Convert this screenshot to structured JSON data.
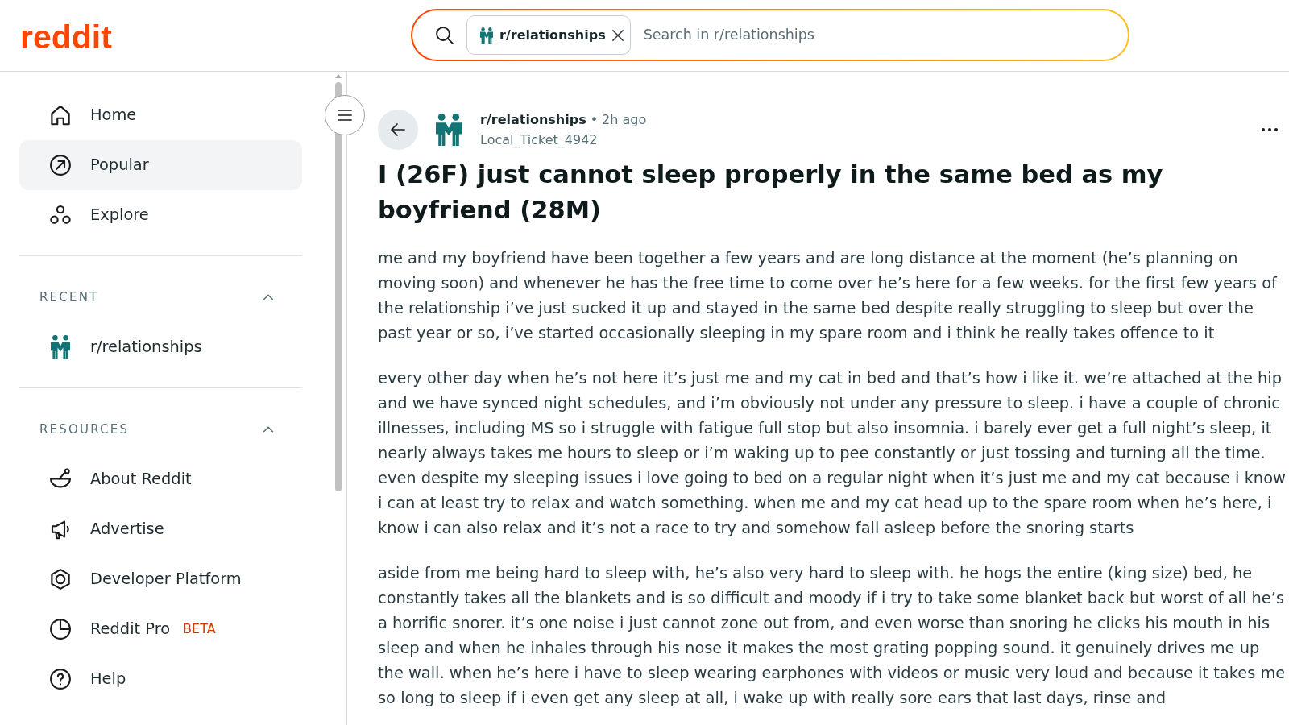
{
  "header": {
    "logo": "reddit",
    "search": {
      "chip": {
        "label": "r/relationships"
      },
      "placeholder": "Search in r/relationships"
    }
  },
  "sidebar": {
    "items": [
      {
        "label": "Home",
        "selected": false
      },
      {
        "label": "Popular",
        "selected": true
      },
      {
        "label": "Explore",
        "selected": false
      }
    ],
    "sections": [
      {
        "title": "RECENT",
        "expanded": true,
        "items": [
          {
            "label": "r/relationships"
          }
        ]
      },
      {
        "title": "RESOURCES",
        "expanded": true,
        "items": [
          {
            "label": "About Reddit"
          },
          {
            "label": "Advertise"
          },
          {
            "label": "Developer Platform"
          },
          {
            "label": "Reddit Pro",
            "badge": "BETA"
          },
          {
            "label": "Help"
          }
        ]
      }
    ]
  },
  "post": {
    "subreddit": "r/relationships",
    "separator": "•",
    "time": "2h ago",
    "author": "Local_Ticket_4942",
    "title": "I (26F) just cannot sleep properly in the same bed as my boyfriend (28M)",
    "paragraphs": [
      "me and my boyfriend have been together a few years and are long distance at the moment (he’s planning on moving soon) and whenever he has the free time to come over he’s here for a few weeks. for the first few years of the relationship i’ve just sucked it up and stayed in the same bed despite really struggling to sleep but over the past year or so, i’ve started occasionally sleeping in my spare room and i think he really takes offence to it",
      "every other day when he’s not here it’s just me and my cat in bed and that’s how i like it. we’re attached at the hip and we have synced night schedules, and i’m obviously not under any pressure to sleep. i have a couple of chronic illnesses, including MS so i struggle with fatigue full stop but also insomnia. i barely ever get a full night’s sleep, it nearly always takes me hours to sleep or i’m waking up to pee constantly or just tossing and turning all the time. even despite my sleeping issues i love going to bed on a regular night when it’s just me and my cat because i know i can at least try to relax and watch something. when me and my cat head up to the spare room when he’s here, i know i can also relax and it’s not a race to try and somehow fall asleep before the snoring starts",
      "aside from me being hard to sleep with, he’s also very hard to sleep with. he hogs the entire (king size) bed, he constantly takes all the blankets and is so difficult and moody if i try to take some blanket back but worst of all he’s a horrific snorer. it’s one noise i just cannot zone out from, and even worse than snoring he clicks his mouth in his sleep and when he inhales through his nose it makes the most grating popping sound. it genuinely drives me up the wall. when he’s here i have to sleep wearing earphones with videos or music very loud and because it takes me so long to sleep if i even get any sleep at all, i wake up with really sore ears that last days, rinse and"
    ]
  }
}
